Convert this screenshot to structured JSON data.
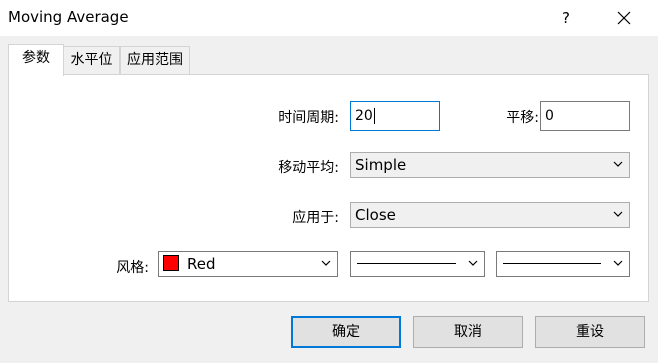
{
  "window": {
    "title": "Moving Average"
  },
  "tabs": [
    {
      "label": "参数"
    },
    {
      "label": "水平位"
    },
    {
      "label": "应用范围"
    }
  ],
  "params": {
    "period_label": "时间周期:",
    "period_value": "20",
    "shift_label": "平移:",
    "shift_value": "0",
    "method_label": "移动平均:",
    "method_value": "Simple",
    "apply_label": "应用于:",
    "apply_value": "Close",
    "style_label": "风格:",
    "color_name": "Red",
    "color_hex": "#ff0000"
  },
  "buttons": {
    "ok": "确定",
    "cancel": "取消",
    "reset": "重设"
  },
  "titlebar_icons": {
    "help": "?",
    "close": "close-icon"
  }
}
